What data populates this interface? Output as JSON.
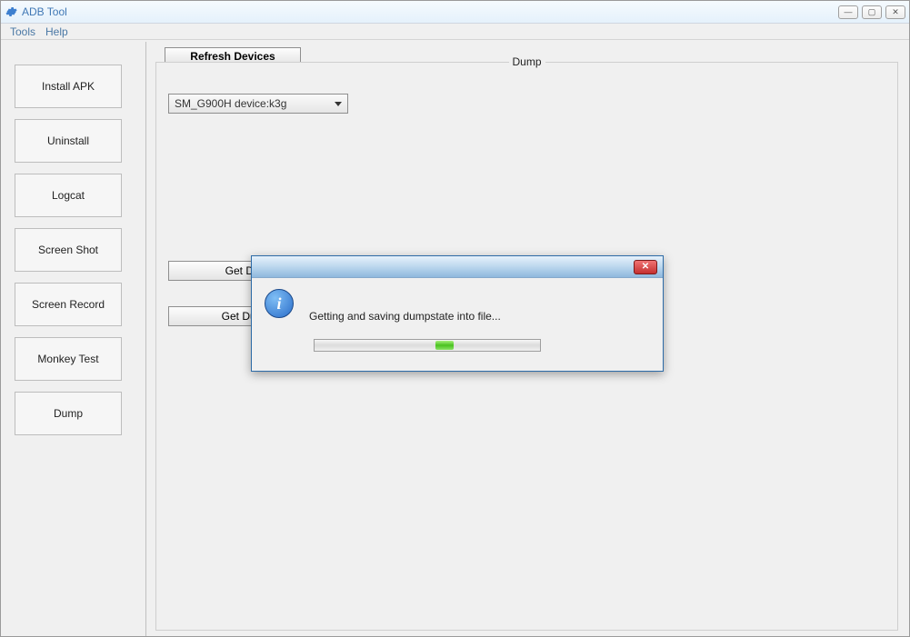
{
  "window": {
    "title": "ADB Tool"
  },
  "titlebar_controls": {
    "min": "—",
    "max": "▢",
    "close": "✕"
  },
  "menubar": {
    "tools": "Tools",
    "help": "Help"
  },
  "sidebar": {
    "items": [
      {
        "label": "Install APK"
      },
      {
        "label": "Uninstall"
      },
      {
        "label": "Logcat"
      },
      {
        "label": "Screen Shot"
      },
      {
        "label": "Screen Record"
      },
      {
        "label": "Monkey Test"
      },
      {
        "label": "Dump"
      }
    ]
  },
  "main": {
    "refresh_label": "Refresh Devices",
    "fieldset_label": "Dump",
    "device_selected": "SM_G900H device:k3g",
    "get_dumpsys_label": "Get Dumpsys",
    "get_dumpstate_label": "Get Dumpstate"
  },
  "dialog": {
    "message": "Getting and saving dumpstate into file...",
    "close_glyph": "✕",
    "info_glyph": "i"
  }
}
